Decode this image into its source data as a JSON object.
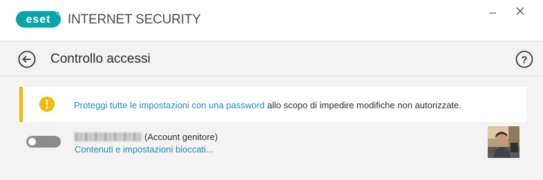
{
  "app": {
    "logo_text": "eset",
    "title": "INTERNET SECURITY",
    "brand_color": "#0aa5a9"
  },
  "window_controls": {
    "minimize_icon": "minimize-icon",
    "close_icon": "close-icon"
  },
  "header": {
    "title": "Controllo accessi",
    "back_icon": "back-arrow-icon",
    "help_icon": "help-icon"
  },
  "banner": {
    "icon": "warning-icon",
    "accent_color": "#f5b800",
    "link_text": "Proteggi tutte le impostazioni con una password",
    "rest_text": " allo scopo di impedire modifiche non autorizzate."
  },
  "account": {
    "toggle_state": "off",
    "role_text": "(Account genitore)",
    "blocked_link": "Contenuti e impostazioni bloccati...",
    "link_color": "#1a8cbb"
  }
}
